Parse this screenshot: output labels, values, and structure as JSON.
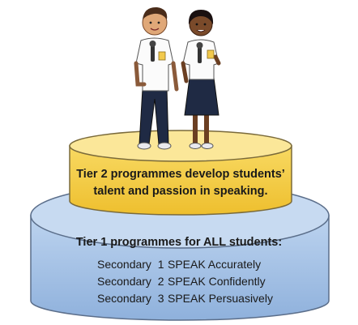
{
  "tier2": {
    "line1": "Tier 2 programmes develop students’",
    "line2": "talent and passion in speaking."
  },
  "tier1": {
    "title": "Tier 1 programmes for ALL students:",
    "rows": [
      {
        "level": "Secondary  1",
        "goal": "SPEAK Accurately"
      },
      {
        "level": "Secondary  2",
        "goal": "SPEAK Confidently"
      },
      {
        "level": "Secondary  3",
        "goal": "SPEAK Persuasively"
      }
    ]
  },
  "colors": {
    "tier1_fill": "#a9c6e8",
    "tier1_top": "#c7daf1",
    "tier2_fill": "#f5cf52",
    "tier2_top": "#fbe799",
    "outline": "#5b6e8a"
  }
}
